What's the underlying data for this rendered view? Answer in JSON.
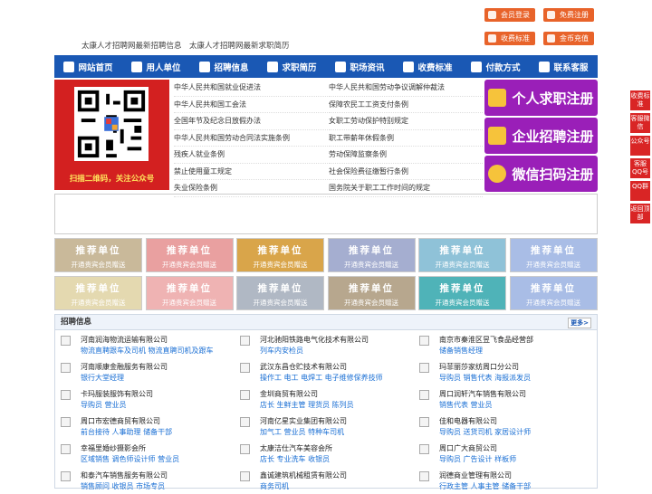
{
  "header": {
    "tagline": "太康人才招聘网最新招聘信息　太康人才招聘网最新求职简历",
    "top_buttons": [
      {
        "label": "会员登录",
        "icon": "user-icon"
      },
      {
        "label": "免费注册",
        "icon": "register-icon"
      },
      {
        "label": "收费标准",
        "icon": "price-icon"
      },
      {
        "label": "金币充值",
        "icon": "coin-icon"
      }
    ],
    "accent": "#e8632a"
  },
  "nav": {
    "color": "#1a58b4",
    "items": [
      {
        "label": "网站首页",
        "icon": "home-icon"
      },
      {
        "label": "用人单位",
        "icon": "building-icon"
      },
      {
        "label": "招聘信息",
        "icon": "recruit-icon"
      },
      {
        "label": "求职简历",
        "icon": "resume-icon"
      },
      {
        "label": "职场资讯",
        "icon": "news-icon"
      },
      {
        "label": "收费标准",
        "icon": "price-icon"
      },
      {
        "label": "付款方式",
        "icon": "payment-icon"
      },
      {
        "label": "联系客服",
        "icon": "service-icon"
      }
    ]
  },
  "qr": {
    "caption": "扫描二维码，关注公众号"
  },
  "laws_left": [
    "中华人民共和国就业促进法",
    "中华人民共和国工会法",
    "全国年节及纪念日放假办法",
    "中华人民共和国劳动合同法实施条例",
    "残疾人就业条例",
    "禁止使用童工规定",
    "失业保险条例"
  ],
  "laws_right": [
    "中华人民共和国劳动争议调解仲裁法",
    "保障农民工工资支付条例",
    "女职工劳动保护特别规定",
    "职工带薪年休假条例",
    "劳动保障监察条例",
    "社会保险费征缴暂行条例",
    "国务院关于职工工作时间的规定"
  ],
  "register": [
    {
      "label": "个人求职注册",
      "icon": "person-icon"
    },
    {
      "label": "企业招聘注册",
      "icon": "company-icon"
    },
    {
      "label": "微信扫码注册",
      "icon": "wechat-icon"
    }
  ],
  "recommend": {
    "title": "推荐单位",
    "subtitle": "开通贵宾会员赠送",
    "colors": [
      "#c9b99a",
      "#e9a0a0",
      "#d9a54a",
      "#a5aed0",
      "#8fc2d8",
      "#a9bde6",
      "#e4d9b0",
      "#efb3b3",
      "#b0b8c4",
      "#b7a78e",
      "#4fb3b8",
      "#a9bde6"
    ]
  },
  "jobs": {
    "title": "招聘信息",
    "more": "更多>",
    "rows": [
      [
        {
          "company": "河南润海物流运输有限公司",
          "jobs": "物流直聘跟车及司机 物流直聘司机及跟车"
        },
        {
          "company": "河北驰阳铁路电气化技术有限公司",
          "jobs": "列车内安检员"
        },
        {
          "company": "南京市秦淮区昱飞食品经营部",
          "jobs": "储备销售经理"
        }
      ],
      [
        {
          "company": "河南顺康金融服务有限公司",
          "jobs": "银行大堂经理"
        },
        {
          "company": "武汉东昌仓贮技术有限公司",
          "jobs": "操作工 电工 电焊工 电子维修保养技师"
        },
        {
          "company": "玛菲丽莎家纺周口分公司",
          "jobs": "导购员 销售代表 海报派发员"
        }
      ],
      [
        {
          "company": "卡玛服装服饰有限公司",
          "jobs": "导购员 营业员"
        },
        {
          "company": "金圳商贸有限公司",
          "jobs": "店长 生鲜主管 理货员 陈列员"
        },
        {
          "company": "周口润轩汽车销售有限公司",
          "jobs": "销售代表 营业员"
        }
      ],
      [
        {
          "company": "周口市宏德商贸有限公司",
          "jobs": "前台接待 人事助理 储备干部"
        },
        {
          "company": "河南亿星实业集团有限公司",
          "jobs": "加气工 营业员 特种车司机"
        },
        {
          "company": "佳和电器有限公司",
          "jobs": "导购员 送货司机 家居设计师"
        }
      ],
      [
        {
          "company": "幸福里婚纱摄影会所",
          "jobs": "区域销售 调色师设计师 营业员"
        },
        {
          "company": "太康洁仕汽车美容会所",
          "jobs": "店长 专业洗车 收银员"
        },
        {
          "company": "周口广大商贸公司",
          "jobs": "导购员 广告设计 样板师"
        }
      ],
      [
        {
          "company": "和泰汽车销售服务有限公司",
          "jobs": "销售顾问 收银员 市场专员"
        },
        {
          "company": "鑫诚建筑机械租赁有限公司",
          "jobs": "商务司机"
        },
        {
          "company": "润德商业管理有限公司",
          "jobs": "行政主管 人事主管 储备干部"
        }
      ]
    ]
  },
  "side": [
    "收费标准",
    "客服微信",
    "公众号",
    "客服QQ号",
    "QQ群",
    "返回顶部"
  ]
}
